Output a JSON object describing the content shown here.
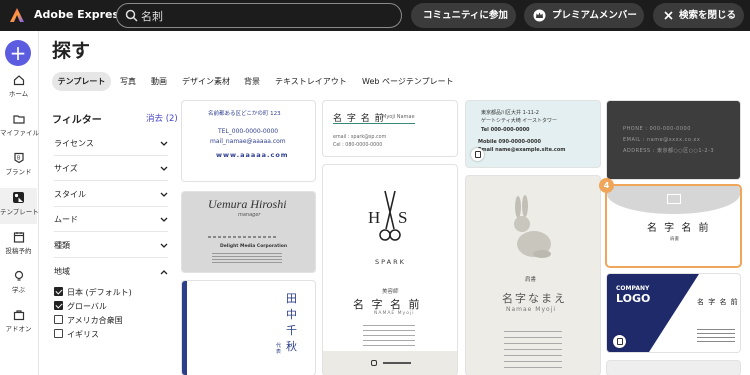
{
  "app": {
    "name": "Adobe Express"
  },
  "search": {
    "value": "名刺"
  },
  "header_buttons": {
    "community": "コミュニティに参加",
    "premium": "プレミアムメンバー",
    "close_search": "検索を閉じる"
  },
  "sidebar": {
    "items": [
      {
        "label": "ホーム"
      },
      {
        "label": "マイファイル"
      },
      {
        "label": "ブランド"
      },
      {
        "label": "テンプレート"
      },
      {
        "label": "投稿予約"
      },
      {
        "label": "学ぶ"
      },
      {
        "label": "アドオン"
      }
    ]
  },
  "page": {
    "heading": "探す"
  },
  "tabs": [
    "テンプレート",
    "写真",
    "動画",
    "デザイン素材",
    "背景",
    "テキストレイアウト",
    "Web ページテンプレート"
  ],
  "filters": {
    "title": "フィルター",
    "clear": "消去 (2)",
    "sections": [
      "ライセンス",
      "サイズ",
      "スタイル",
      "ムード",
      "種類",
      "地域"
    ],
    "region_options": [
      {
        "label": "日本 (デフォルト)",
        "checked": true
      },
      {
        "label": "グローバル",
        "checked": true
      },
      {
        "label": "アメリカ合衆国",
        "checked": false
      },
      {
        "label": "イギリス",
        "checked": false
      }
    ]
  },
  "cards": {
    "c1": {
      "line1": "名前都ある区どこかの町 123",
      "line2": "TEL_000-0000-0000",
      "line3": "mail_namae@aaaaa.com",
      "line4": "www.aaaaa.com"
    },
    "c2": {
      "name": "Uemura Hiroshi",
      "title": "manager",
      "company": "Delight Media Corporation"
    },
    "c3": {
      "name": "田中千秋",
      "sub": "代表"
    },
    "c4": {
      "name": "名 字 名 前",
      "reading": "Myoji Namae",
      "email": "email : spark@sp.com",
      "cell": "Cel : 080-0000-0000"
    },
    "c5": {
      "name": "名 字 名 前",
      "brand": "SPARK",
      "label": "美容師",
      "reading": "NAMAE Myoji"
    },
    "c6": {
      "addr": "東京都品川区大井 1-11-2",
      "building": "ゲートシティ大崎 イーストタワー",
      "tel": "Tel 000-000-0000",
      "mobile": "Mobile 090-0000-0000",
      "email": "Email name@example.site.com"
    },
    "c7": {
      "name": "名字なまえ",
      "label": "肩書",
      "romaji": "Namae Myoji"
    },
    "c8": {
      "phone": "PHONE : 000-000-0000",
      "email": "EMAIL : name@xxxx.co.xx",
      "address": "ADDRESS : 東京都○○区○○1-2-3"
    },
    "c9": {
      "name": "名 字 名 前",
      "label": "肩書",
      "badge": "4"
    },
    "c10": {
      "company": "COMPANY",
      "logo": "LOGO",
      "name": "名 字 名 前"
    }
  }
}
